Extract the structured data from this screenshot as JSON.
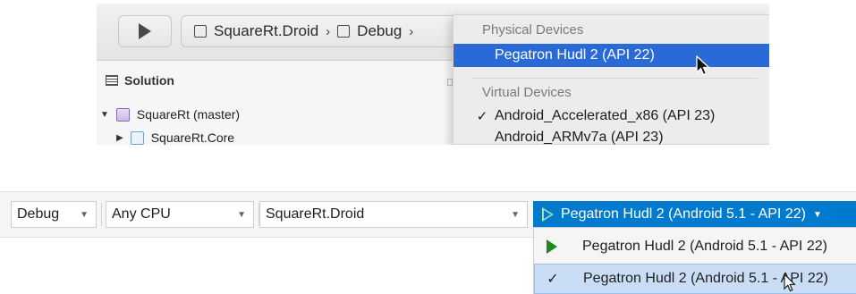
{
  "mac": {
    "toolbar": {
      "project_label": "SquareRt.Droid",
      "config_label": "Debug",
      "separator": "›"
    },
    "sidebar": {
      "heading": "Solution",
      "tree": [
        {
          "label": "SquareRt (master)",
          "expanded": true,
          "icon": "solution-project-icon"
        },
        {
          "label": "SquareRt.Core",
          "expanded": false,
          "icon": "project-icon"
        }
      ]
    },
    "device_menu": {
      "sections": [
        {
          "heading": "Physical Devices",
          "items": [
            {
              "label": "Pegatron Hudl 2 (API 22)",
              "selected": true,
              "checked": false
            }
          ]
        },
        {
          "heading": "Virtual Devices",
          "items": [
            {
              "label": "Android_Accelerated_x86 (API 23)",
              "selected": false,
              "checked": true
            },
            {
              "label": "Android_ARMv7a (API 23)",
              "selected": false,
              "checked": false
            }
          ]
        }
      ],
      "check_glyph": "✓",
      "highlight_color": "#2a6ad6"
    }
  },
  "win": {
    "toolbar": {
      "configuration": "Debug",
      "platform": "Any CPU",
      "startup_project": "SquareRt.Droid",
      "run_target": "Pegatron Hudl 2 (Android 5.1 - API 22)",
      "run_color": "#007acc"
    },
    "device_menu": {
      "items": [
        {
          "label": "Pegatron Hudl 2 (Android 5.1 - API 22)",
          "marker": "green-play-icon",
          "highlighted": false
        },
        {
          "label": "Pegatron Hudl 2 (Android 5.1 - API 22)",
          "marker": "checkmark-icon",
          "highlighted": true
        }
      ],
      "check_glyph": "✓",
      "highlight_color": "#c9def5"
    }
  }
}
